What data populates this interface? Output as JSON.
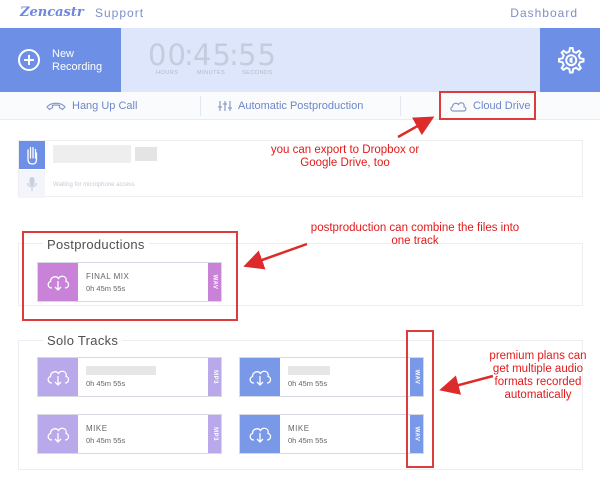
{
  "nav": {
    "logo": "Zencastr",
    "support": "Support",
    "dashboard": "Dashboard"
  },
  "recording": {
    "new_label": "New Recording",
    "timer": {
      "hours": "00",
      "minutes": "45",
      "seconds": "55"
    },
    "units": {
      "hours": "HOURS",
      "minutes": "MINUTES",
      "seconds": "SECONDS"
    }
  },
  "actions": {
    "hang_up": "Hang Up Call",
    "postproduction": "Automatic Postproduction",
    "cloud_drive": "Cloud Drive"
  },
  "mic": {
    "status": "Waiting for microphone access"
  },
  "postproductions": {
    "title": "Postproductions",
    "items": [
      {
        "name": "FINAL MIX",
        "duration": "0h 45m 55s",
        "format": "WAV",
        "color": "#c882d8"
      }
    ]
  },
  "solo_tracks": {
    "title": "Solo Tracks",
    "items": [
      {
        "name": "",
        "duration": "0h 45m 55s",
        "format": "MP3",
        "color": "#b9a9ea"
      },
      {
        "name": "",
        "duration": "0h 45m 55s",
        "format": "WAV",
        "color": "#7a98e8"
      },
      {
        "name": "MIKE",
        "duration": "0h 45m 55s",
        "format": "MP3",
        "color": "#b9a9ea"
      },
      {
        "name": "MIKE",
        "duration": "0h 45m 55s",
        "format": "WAV",
        "color": "#7a98e8"
      }
    ]
  },
  "annotations": {
    "cloud": "you can export to Dropbox or Google Drive, too",
    "postproduction": "postproduction can combine the files into one track",
    "premium": "premium plans can get multiple audio formats recorded automatically"
  },
  "colors": {
    "accent": "#6d8fe6",
    "annotation": "#e21a1a"
  }
}
